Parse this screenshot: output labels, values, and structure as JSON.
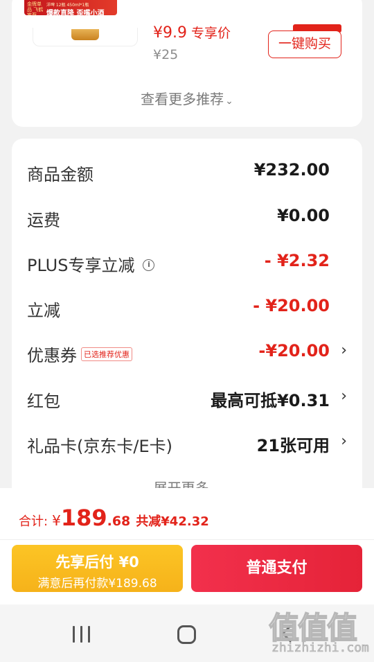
{
  "recommendation": {
    "banner_brand": "金牌单品 飞鹤推荐",
    "banner_small": "洋啤 12瓶 450ml*1瓶",
    "banner_title": "爆款直降 歪嘴小酒",
    "price": "¥9.9",
    "price_tag": "专享价",
    "original_price": "¥25",
    "buy_button": "一键购买",
    "more_label": "查看更多推荐",
    "chevron": "⌄"
  },
  "summary": {
    "goods_amount": {
      "label": "商品金额",
      "value": "¥232.00"
    },
    "shipping": {
      "label": "运费",
      "value": "¥0.00"
    },
    "plus_discount": {
      "label": "PLUS专享立减",
      "info": "i",
      "value": "- ¥2.32"
    },
    "instant_discount": {
      "label": "立减",
      "value": "- ¥20.00"
    },
    "coupon": {
      "label": "优惠券",
      "tag": "已选推荐优惠",
      "value": "-¥20.00",
      "arrow": "›"
    },
    "red_packet": {
      "label": "红包",
      "value": "最高可抵¥0.31",
      "arrow": "›"
    },
    "gift_card": {
      "label": "礼品卡(京东卡/E卡)",
      "value": "21张可用",
      "arrow": "›"
    },
    "expand_label": "展开更多",
    "expand_chevron": "⌄"
  },
  "checkout": {
    "total_label": "合计:",
    "currency": "¥",
    "total_int": "189",
    "total_dec": ".68",
    "total_saved": "共减¥42.32",
    "pay_later_title": "先享后付 ¥0",
    "pay_later_sub": "满意后再付款¥189.68",
    "pay_button": "普通支付"
  },
  "watermark": {
    "mark": "值值值",
    "site": "zhizhizhi.com"
  },
  "colors": {
    "accent": "#e2231a",
    "pay_later": "#f6b21a",
    "pay": "#e52338"
  }
}
